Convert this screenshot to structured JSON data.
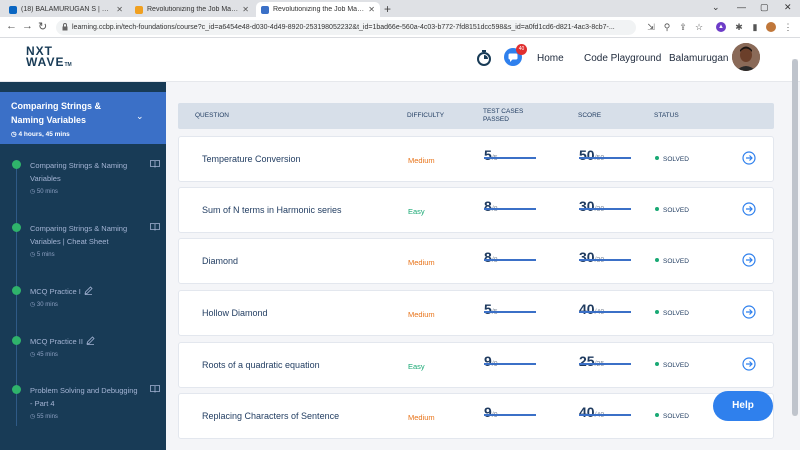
{
  "browser": {
    "tabs": [
      {
        "label": "(18) BALAMURUGAN S | LinkedIn",
        "active": false,
        "icon": "linkedin-icon",
        "color": "#0a66c2"
      },
      {
        "label": "Revolutionizing the Job Market |",
        "active": false,
        "icon": "ccbp-icon",
        "color": "#f0a020"
      },
      {
        "label": "Revolutionizing the Job Market |",
        "active": true,
        "icon": "ccbp-icon",
        "color": "#3b70c7"
      }
    ],
    "new_tab": "+",
    "url": "learning.ccbp.in/tech-foundations/course?c_id=a6454e48-d030-4d49-8920-253198052232&t_id=1bad66e-560a-4c03-b772-7fd8151dcc598&s_id=a0fd1cd6-d821-4ac3-8cb7-..."
  },
  "header": {
    "logo_top": "NXT",
    "logo_bottom": "WAVE",
    "logo_tm": "TM",
    "chat_badge": "40",
    "nav": {
      "home": "Home",
      "playground": "Code Playground",
      "user": "Balamurugan"
    }
  },
  "sidebar": {
    "current": {
      "title": "Comparing Strings & Naming Variables",
      "duration": "4 hours, 45 mins"
    },
    "items": [
      {
        "label": "Comparing Strings & Naming Variables",
        "time": "50 mins",
        "icon": "book-icon"
      },
      {
        "label": "Comparing Strings & Naming Variables | Cheat Sheet",
        "time": "5 mins",
        "icon": "book-icon"
      },
      {
        "label": "MCQ Practice I",
        "time": "30 mins",
        "icon": "pencil-icon"
      },
      {
        "label": "MCQ Practice II",
        "time": "45 mins",
        "icon": "pencil-icon"
      },
      {
        "label": "Problem Solving and Debugging - Part 4",
        "time": "55 mins",
        "icon": "book-icon"
      }
    ]
  },
  "table": {
    "headers": {
      "question": "QUESTION",
      "difficulty": "DIFFICULTY",
      "test_cases": "TEST CASES PASSED",
      "score": "SCORE",
      "status": "STATUS"
    },
    "rows": [
      {
        "question": "Temperature Conversion",
        "difficulty": "Medium",
        "passed": "5",
        "total": "/5",
        "score": "50",
        "max": "/50",
        "status": "SOLVED"
      },
      {
        "question": "Sum of N terms in Harmonic series",
        "difficulty": "Easy",
        "passed": "8",
        "total": "/8",
        "score": "30",
        "max": "/30",
        "status": "SOLVED"
      },
      {
        "question": "Diamond",
        "difficulty": "Medium",
        "passed": "8",
        "total": "/8",
        "score": "30",
        "max": "/30",
        "status": "SOLVED"
      },
      {
        "question": "Hollow Diamond",
        "difficulty": "Medium",
        "passed": "5",
        "total": "/5",
        "score": "40",
        "max": "/40",
        "status": "SOLVED"
      },
      {
        "question": "Roots of a quadratic equation",
        "difficulty": "Easy",
        "passed": "9",
        "total": "/9",
        "score": "25",
        "max": "/25",
        "status": "SOLVED"
      },
      {
        "question": "Replacing Characters of Sentence",
        "difficulty": "Medium",
        "passed": "9",
        "total": "/9",
        "score": "40",
        "max": "/40",
        "status": "SOLVED"
      }
    ]
  },
  "help_label": "Help",
  "colors": {
    "medium": "#e8741a",
    "easy": "#19a974",
    "accent": "#3b70c7",
    "sidebar": "#183b56",
    "solved": "#19a974"
  }
}
